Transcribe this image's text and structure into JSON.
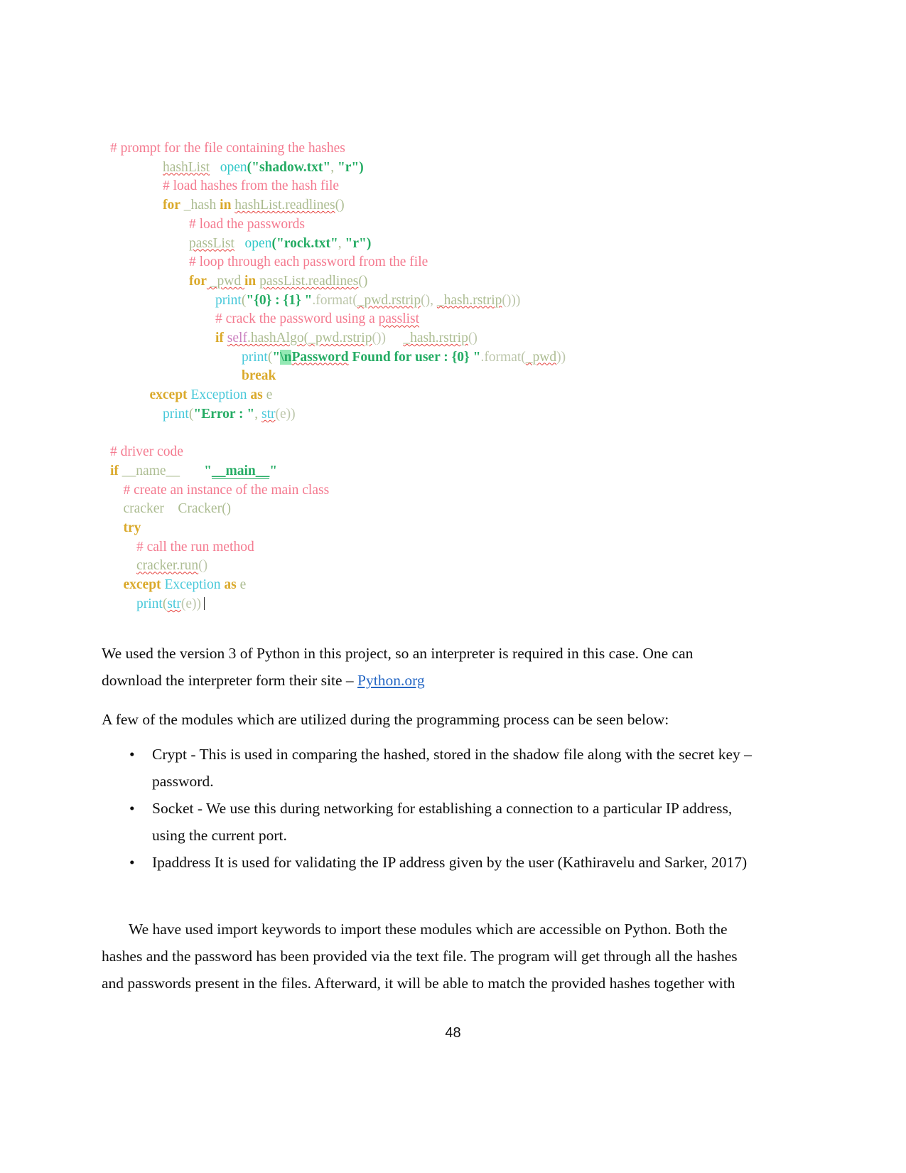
{
  "document": {
    "page_number": "48"
  },
  "code_screenshot": {
    "name": "python-code-screenshot",
    "lines": [
      {
        "indent": 0,
        "segments": [
          {
            "t": "# prompt for the file containing the hashes",
            "c": "tk-comment"
          }
        ]
      },
      {
        "indent": 4,
        "segments": [
          {
            "t": "hashList",
            "c": "tk-var sq"
          },
          {
            "t": "   ",
            "c": "tk-plain"
          },
          {
            "t": "open",
            "c": "tk-builtin"
          },
          {
            "t": "(",
            "c": "tk-str"
          },
          {
            "t": "\"shadow.txt\"",
            "c": "tk-str"
          },
          {
            "t": ", ",
            "c": "tk-punct"
          },
          {
            "t": "\"r\"",
            "c": "tk-str"
          },
          {
            "t": ")",
            "c": "tk-str"
          }
        ]
      },
      {
        "indent": 4,
        "segments": [
          {
            "t": "# load hashes from the hash file",
            "c": "tk-comment"
          }
        ]
      },
      {
        "indent": 4,
        "segments": [
          {
            "t": "for",
            "c": "tk-kw"
          },
          {
            "t": " _hash ",
            "c": "tk-var"
          },
          {
            "t": "in",
            "c": "tk-kw"
          },
          {
            "t": " ",
            "c": "tk-plain"
          },
          {
            "t": "hashList.readlines",
            "c": "tk-var sq"
          },
          {
            "t": "()",
            "c": "tk-punct"
          }
        ]
      },
      {
        "indent": 6,
        "segments": [
          {
            "t": "# load the passwords",
            "c": "tk-comment"
          }
        ]
      },
      {
        "indent": 6,
        "segments": [
          {
            "t": "passList",
            "c": "tk-var sq"
          },
          {
            "t": "   ",
            "c": "tk-plain"
          },
          {
            "t": "open",
            "c": "tk-builtin"
          },
          {
            "t": "(",
            "c": "tk-str"
          },
          {
            "t": "\"rock.txt\"",
            "c": "tk-str"
          },
          {
            "t": ", ",
            "c": "tk-punct"
          },
          {
            "t": "\"r\"",
            "c": "tk-str"
          },
          {
            "t": ")",
            "c": "tk-str"
          }
        ]
      },
      {
        "indent": 6,
        "segments": [
          {
            "t": "# loop through each password from the file",
            "c": "tk-comment"
          }
        ]
      },
      {
        "indent": 6,
        "segments": [
          {
            "t": "for",
            "c": "tk-kw"
          },
          {
            "t": " _pwd ",
            "c": "tk-var sq"
          },
          {
            "t": "in",
            "c": "tk-kw"
          },
          {
            "t": " ",
            "c": "tk-plain"
          },
          {
            "t": "passList.readlines",
            "c": "tk-var sq"
          },
          {
            "t": "()",
            "c": "tk-punct"
          }
        ]
      },
      {
        "indent": 8,
        "segments": [
          {
            "t": "print",
            "c": "tk-cls"
          },
          {
            "t": "(",
            "c": "tk-punct"
          },
          {
            "t": "\"{0} : {1} \"",
            "c": "tk-str"
          },
          {
            "t": ".format(",
            "c": "tk-plain"
          },
          {
            "t": "_pwd.rstrip",
            "c": "tk-var sq"
          },
          {
            "t": "(), ",
            "c": "tk-plain"
          },
          {
            "t": "_hash.rstrip",
            "c": "tk-var sq"
          },
          {
            "t": "()))",
            "c": "tk-plain"
          }
        ]
      },
      {
        "indent": 8,
        "segments": [
          {
            "t": "# crack the password using a ",
            "c": "tk-comment"
          },
          {
            "t": "passlist",
            "c": "tk-comment sq"
          }
        ]
      },
      {
        "indent": 8,
        "segments": [
          {
            "t": "if",
            "c": "tk-kw"
          },
          {
            "t": " ",
            "c": "tk-plain"
          },
          {
            "t": "self",
            "c": "tk-self sq"
          },
          {
            "t": ".hashAlgo(",
            "c": "tk-var sq"
          },
          {
            "t": "_pwd.rstrip",
            "c": "tk-var sq"
          },
          {
            "t": "())",
            "c": "tk-plain"
          },
          {
            "t": "     ",
            "c": "tk-plain"
          },
          {
            "t": "_hash.rstrip",
            "c": "tk-var sq"
          },
          {
            "t": "()",
            "c": "tk-plain"
          }
        ]
      },
      {
        "indent": 10,
        "segments": [
          {
            "t": "print",
            "c": "tk-cls"
          },
          {
            "t": "(",
            "c": "tk-punct"
          },
          {
            "t": "\"",
            "c": "tk-str"
          },
          {
            "t": "\\n",
            "c": "tk-esc"
          },
          {
            "t": "Password",
            "c": "tk-str sq"
          },
          {
            "t": " Found for user : {0} \"",
            "c": "tk-str"
          },
          {
            "t": ".format(",
            "c": "tk-plain"
          },
          {
            "t": "_pwd",
            "c": "tk-var sq"
          },
          {
            "t": "))",
            "c": "tk-plain"
          }
        ]
      },
      {
        "indent": 10,
        "segments": [
          {
            "t": "break",
            "c": "tk-kw"
          }
        ]
      },
      {
        "indent": 3,
        "segments": [
          {
            "t": "except",
            "c": "tk-kw"
          },
          {
            "t": " ",
            "c": "tk-plain"
          },
          {
            "t": "Exception",
            "c": "tk-cls"
          },
          {
            "t": " ",
            "c": "tk-plain"
          },
          {
            "t": "as",
            "c": "tk-kw"
          },
          {
            "t": " e",
            "c": "tk-var"
          }
        ]
      },
      {
        "indent": 4,
        "segments": [
          {
            "t": "print",
            "c": "tk-cls"
          },
          {
            "t": "(",
            "c": "tk-punct"
          },
          {
            "t": "\"Error : \"",
            "c": "tk-str"
          },
          {
            "t": ", ",
            "c": "tk-punct"
          },
          {
            "t": "str",
            "c": "tk-cls sq"
          },
          {
            "t": "(e))",
            "c": "tk-plain"
          }
        ]
      },
      {
        "indent": 0,
        "segments": [],
        "blank": true
      },
      {
        "indent": 0,
        "segments": [
          {
            "t": "# driver code",
            "c": "tk-comment"
          }
        ]
      },
      {
        "indent": 0,
        "segments": [
          {
            "t": "if",
            "c": "tk-kw"
          },
          {
            "t": " ",
            "c": "tk-plain"
          },
          {
            "t": "__name__",
            "c": "tk-var"
          },
          {
            "t": "       ",
            "c": "tk-plain"
          },
          {
            "t": "\"",
            "c": "tk-str"
          },
          {
            "t": "__main__",
            "c": "tk-str ul"
          },
          {
            "t": "\"",
            "c": "tk-str"
          }
        ]
      },
      {
        "indent": 1,
        "segments": [
          {
            "t": "# create an instance of the main class",
            "c": "tk-comment"
          }
        ]
      },
      {
        "indent": 1,
        "segments": [
          {
            "t": "cracker",
            "c": "tk-var"
          },
          {
            "t": "    ",
            "c": "tk-plain"
          },
          {
            "t": "Cracker()",
            "c": "tk-var"
          }
        ]
      },
      {
        "indent": 1,
        "segments": [
          {
            "t": "try",
            "c": "tk-kw"
          }
        ]
      },
      {
        "indent": 2,
        "segments": [
          {
            "t": "# call the run method",
            "c": "tk-comment"
          }
        ]
      },
      {
        "indent": 2,
        "segments": [
          {
            "t": "cracker.run",
            "c": "tk-var sq"
          },
          {
            "t": "()",
            "c": "tk-plain"
          }
        ]
      },
      {
        "indent": 1,
        "segments": [
          {
            "t": "except",
            "c": "tk-kw"
          },
          {
            "t": " ",
            "c": "tk-plain"
          },
          {
            "t": "Exception",
            "c": "tk-cls"
          },
          {
            "t": " ",
            "c": "tk-plain"
          },
          {
            "t": "as",
            "c": "tk-kw"
          },
          {
            "t": " e",
            "c": "tk-var"
          }
        ]
      },
      {
        "indent": 2,
        "segments": [
          {
            "t": "print",
            "c": "tk-cls"
          },
          {
            "t": "(",
            "c": "tk-punct"
          },
          {
            "t": "str",
            "c": "tk-cls sq"
          },
          {
            "t": "(e))",
            "c": "tk-plain"
          }
        ],
        "caret": true
      }
    ]
  },
  "body": {
    "paragraph_1_part_1": "We used the version 3 of Python in this project, so an interpreter is required in this case. One can download the interpreter form their site – ",
    "paragraph_1_link": "Python.org",
    "paragraph_2": "A few of the modules which are utilized during the programming process can be seen below:",
    "bullets": [
      {
        "marker": "•",
        "text": "Crypt - This is used in comparing the hashed, stored in the shadow file along with the secret key – password."
      },
      {
        "marker": "•",
        "text": "Socket - We use this during networking for establishing a connection to a particular IP address, using  the current port."
      },
      {
        "marker": "•",
        "text": "Ipaddress  It is used for validating the IP address given by the user (Kathiravelu and Sarker, 2017)"
      }
    ],
    "paragraph_3": "We have used import keywords to import these modules which are accessible on Python. Both the hashes and the password has been provided via the text file. The program will get through all the hashes and passwords present in the files. Afterward, it will be able to match the provided hashes together with"
  }
}
